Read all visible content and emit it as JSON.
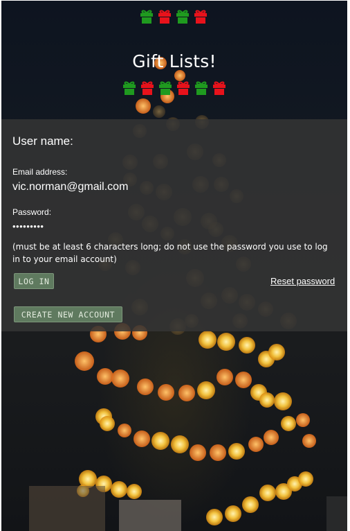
{
  "header": {
    "title": "Gift Lists!",
    "gifts_top": [
      "green",
      "red",
      "green",
      "red"
    ],
    "gifts_bottom": [
      "green",
      "red",
      "green",
      "red",
      "green",
      "red"
    ],
    "gift_colors": {
      "green": "#1f9a1f",
      "red": "#e8121b"
    },
    "gift_icon": "gift-icon"
  },
  "form": {
    "username_label": "User name:",
    "email_label": "Email address:",
    "email_value": "vic.norman@gmail.com",
    "password_label": "Password:",
    "password_value": "•••••••••",
    "password_hint": "(must be at least 6 characters long; do not use the password you use to log in to your email account)",
    "login_button": "LOG IN",
    "reset_link": "Reset password",
    "create_button": "CREATE NEW ACCOUNT"
  },
  "theme": {
    "button_bg": "#5f7a5f",
    "panel_bg": "rgba(52,52,52,0.86)"
  }
}
